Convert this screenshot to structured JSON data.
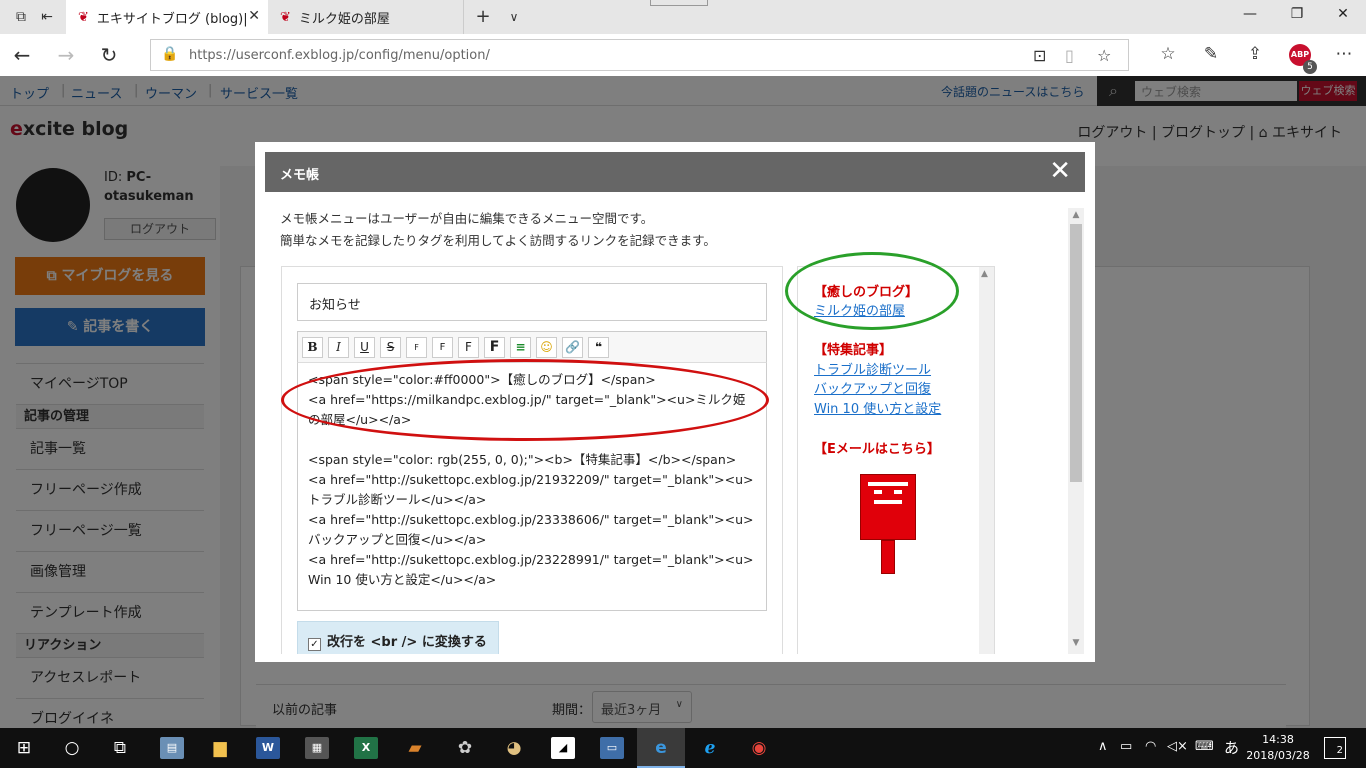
{
  "browser": {
    "tabs": [
      {
        "label": "エキサイトブログ (blog)|表ﾃ",
        "active": true
      },
      {
        "label": "ミルク姫の部屋",
        "active": false
      }
    ],
    "url": "https://userconf.exblog.jp/config/menu/option/",
    "abp_label": "ABP",
    "abp_count": "5"
  },
  "site": {
    "nav": [
      "トップ",
      "ニュース",
      "ウーマン",
      "サービス一覧"
    ],
    "news_link": "今話題のニュースはこちら",
    "search_placeholder": "ウェブ検索",
    "search_button": "ウェブ検索",
    "logo": {
      "e": "e",
      "rest": "xcite blog"
    },
    "top_links": "ログアウト | ブログトップ | ⌂ エキサイト",
    "user_id_label": "ID:",
    "user_id": "PC-otasukeman",
    "logout": "ログアウト",
    "my_blog_button": "マイブログを見る",
    "write_button": "記事を書く",
    "side_menu": {
      "mypage": "マイページTOP",
      "section_articles": "記事の管理",
      "article_list": "記事一覧",
      "free_page_create": "フリーページ作成",
      "free_page_list": "フリーページ一覧",
      "image_manage": "画像管理",
      "template_create": "テンプレート作成",
      "section_reaction": "リアクション",
      "access_report": "アクセスレポート",
      "blog_like": "ブログイイネ"
    },
    "prev_articles": "以前の記事",
    "period_label": "期間：",
    "period_value": "最近3ヶ月"
  },
  "modal": {
    "title": "メモ帳",
    "close": "✕",
    "desc_line1": "メモ帳メニューはユーザーが自由に編集できるメニュー空間です。",
    "desc_line2": "簡単なメモを記録したりタグを利用してよく訪問するリンクを記録できます。",
    "title_input_value": "お知らせ",
    "toolbar": [
      "B",
      "I",
      "U",
      "S",
      "F",
      "F",
      "F",
      "F",
      "≡",
      "☺",
      "🔗",
      "❝"
    ],
    "code_lines_1": [
      "<span style=\"color:#ff0000\">【癒しのブログ】</span>",
      "<a href=\"https://milkandpc.exblog.jp/\" target=\"_blank\"><u>ミルク姫の部屋</u></a>"
    ],
    "code_lines_2": [
      "<span style=\"color: rgb(255, 0, 0);\"><b>【特集記事】</b></span>",
      "<a href=\"http://sukettopc.exblog.jp/21932209/\" target=\"_blank\"><u>トラブル診断ツール</u></a>",
      "<a href=\"http://sukettopc.exblog.jp/23338606/\" target=\"_blank\"><u>バックアップと回復</u></a>",
      "<a href=\"http://sukettopc.exblog.jp/23228991/\" target=\"_blank\"><u>Win 10 使い方と設定</u></a>"
    ],
    "convert_br_label": "改行を <br /> に変換する",
    "convert_br_checked": true,
    "preview": {
      "heading1": "【癒しのブログ】",
      "link1": "ミルク姫の部屋",
      "heading2": "【特集記事】",
      "link2": "トラブル診断ツール",
      "link3": "バックアップと回復",
      "link4": "Win 10 使い方と設定",
      "heading3": "【Eメールはこちら】"
    }
  },
  "taskbar": {
    "ime": "あ",
    "time": "14:38",
    "date": "2018/03/28",
    "notifications": "2"
  },
  "colors": {
    "accent_red": "#d00000",
    "link_blue": "#1a6fc9",
    "annotation_red": "#d01010",
    "annotation_green": "#2aa02a"
  }
}
